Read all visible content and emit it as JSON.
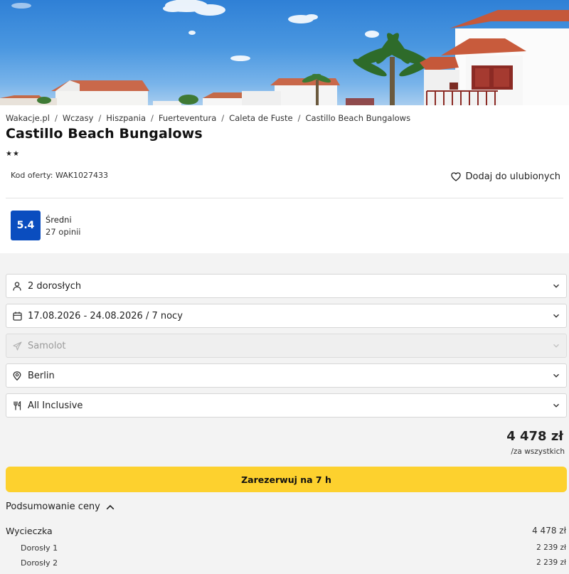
{
  "breadcrumb": [
    "Wakacje.pl",
    "Wczasy",
    "Hiszpania",
    "Fuerteventura",
    "Caleta de Fuste",
    "Castillo Beach Bungalows"
  ],
  "hotel": {
    "title": "Castillo Beach Bungalows",
    "stars": "★★",
    "offer_code": "Kod oferty: WAK1027433",
    "favorite_label": "Dodaj do ulubionych"
  },
  "rating": {
    "score": "5.4",
    "label": "Średni",
    "count": "27 opinii"
  },
  "filters": {
    "guests": {
      "value": "2 dorosłych",
      "icon": "person-icon"
    },
    "dates": {
      "value": "17.08.2026 - 24.08.2026 / 7 nocy",
      "icon": "calendar-icon"
    },
    "transport": {
      "value": "Samolot",
      "icon": "plane-icon",
      "disabled": true
    },
    "departure": {
      "value": "Berlin",
      "icon": "location-pin-icon"
    },
    "board": {
      "value": "All Inclusive",
      "icon": "cutlery-icon"
    }
  },
  "pricing": {
    "total": "4 478 zł",
    "per": "/za wszystkich",
    "book_label": "Zarezerwuj na 7 h",
    "summary_label": "Podsumowanie ceny",
    "trip_label": "Wycieczka",
    "trip_value": "4 478 zł",
    "lines": [
      {
        "label": "Dorosły 1",
        "value": "2 239 zł"
      },
      {
        "label": "Dorosły 2",
        "value": "2 239 zł"
      }
    ]
  },
  "colors": {
    "accent_blue": "#0a4dbf",
    "book_yellow": "#fdd12e",
    "panel_gray": "#f3f3f3"
  }
}
